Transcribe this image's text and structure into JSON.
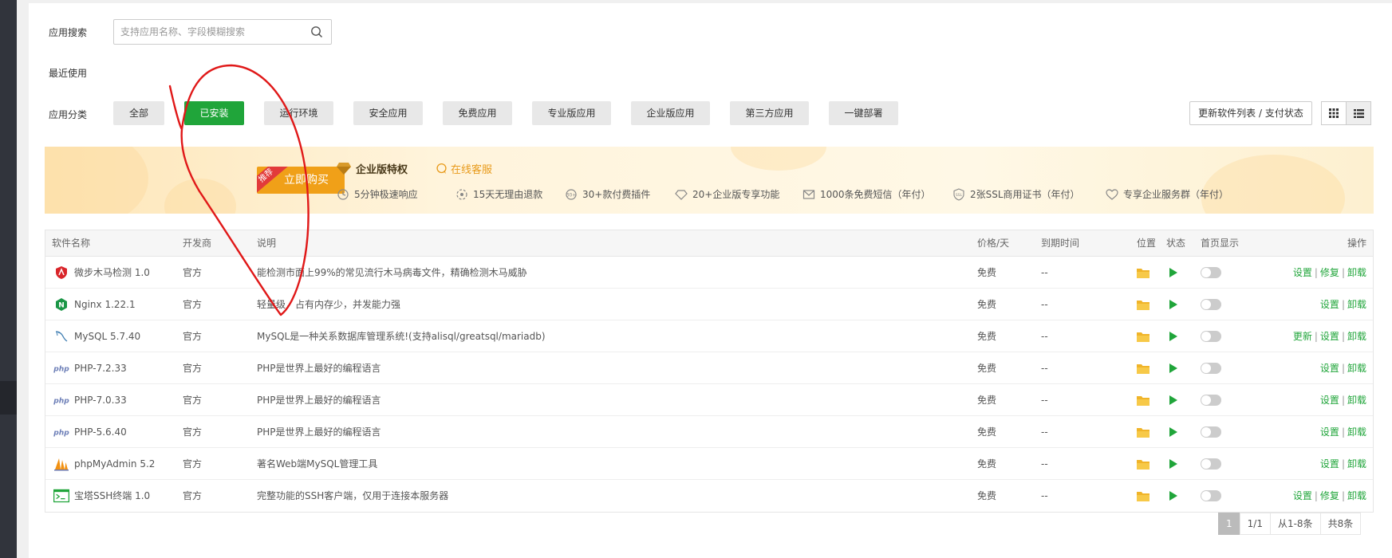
{
  "search": {
    "label": "应用搜索",
    "placeholder": "支持应用名称、字段模糊搜索",
    "value": ""
  },
  "recent": {
    "label": "最近使用"
  },
  "categories": {
    "label": "应用分类",
    "items": [
      {
        "label": "全部",
        "active": false
      },
      {
        "label": "已安装",
        "active": true
      },
      {
        "label": "运行环境",
        "active": false
      },
      {
        "label": "安全应用",
        "active": false
      },
      {
        "label": "免费应用",
        "active": false
      },
      {
        "label": "专业版应用",
        "active": false
      },
      {
        "label": "企业版应用",
        "active": false
      },
      {
        "label": "第三方应用",
        "active": false
      },
      {
        "label": "一键部署",
        "active": false
      }
    ]
  },
  "toolbar": {
    "refresh_label": "更新软件列表 / 支付状态",
    "view_mode": "list"
  },
  "promo": {
    "ribbon": "推荐",
    "buy_label": "立即购买",
    "title": "企业版特权",
    "service_link": "在线客服",
    "features": [
      {
        "icon": "fast-response-icon",
        "label": "5分钟极速响应"
      },
      {
        "icon": "refund-icon",
        "label": "15天无理由退款"
      },
      {
        "icon": "plugin-icon",
        "label": "30+款付费插件"
      },
      {
        "icon": "diamond-icon",
        "label": "20+企业版专享功能"
      },
      {
        "icon": "sms-icon",
        "label": "1000条免费短信（年付）"
      },
      {
        "icon": "ssl-icon",
        "label": "2张SSL商用证书（年付）"
      },
      {
        "icon": "group-icon",
        "label": "专享企业服务群（年付）"
      }
    ]
  },
  "table": {
    "headers": {
      "name": "软件名称",
      "developer": "开发商",
      "description": "说明",
      "price": "价格/天",
      "expiry": "到期时间",
      "location": "位置",
      "status": "状态",
      "home_display": "首页显示",
      "actions": "操作"
    },
    "rows": [
      {
        "icon": "shield-icon",
        "name": "微步木马检测 1.0",
        "developer": "官方",
        "description": "能检测市面上99%的常见流行木马病毒文件，精确检测木马威胁",
        "price": "免费",
        "expiry": "--",
        "actions": [
          "设置",
          "修复",
          "卸载"
        ]
      },
      {
        "icon": "nginx-icon",
        "name": "Nginx 1.22.1",
        "developer": "官方",
        "description": "轻量级，占有内存少，并发能力强",
        "price": "免费",
        "expiry": "--",
        "actions": [
          "设置",
          "卸载"
        ]
      },
      {
        "icon": "mysql-icon",
        "name": "MySQL 5.7.40",
        "developer": "官方",
        "description": "MySQL是一种关系数据库管理系统!(支持alisql/greatsql/mariadb)",
        "price": "免费",
        "expiry": "--",
        "actions": [
          "更新",
          "设置",
          "卸载"
        ]
      },
      {
        "icon": "php-icon",
        "name": "PHP-7.2.33",
        "developer": "官方",
        "description": "PHP是世界上最好的编程语言",
        "price": "免费",
        "expiry": "--",
        "actions": [
          "设置",
          "卸载"
        ]
      },
      {
        "icon": "php-icon",
        "name": "PHP-7.0.33",
        "developer": "官方",
        "description": "PHP是世界上最好的编程语言",
        "price": "免费",
        "expiry": "--",
        "actions": [
          "设置",
          "卸载"
        ]
      },
      {
        "icon": "php-icon",
        "name": "PHP-5.6.40",
        "developer": "官方",
        "description": "PHP是世界上最好的编程语言",
        "price": "免费",
        "expiry": "--",
        "actions": [
          "设置",
          "卸载"
        ]
      },
      {
        "icon": "phpmyadmin-icon",
        "name": "phpMyAdmin 5.2",
        "developer": "官方",
        "description": "著名Web端MySQL管理工具",
        "price": "免费",
        "expiry": "--",
        "actions": [
          "设置",
          "卸载"
        ]
      },
      {
        "icon": "terminal-icon",
        "name": "宝塔SSH终端 1.0",
        "developer": "官方",
        "description": "完整功能的SSH客户端，仅用于连接本服务器",
        "price": "免费",
        "expiry": "--",
        "actions": [
          "设置",
          "修复",
          "卸载"
        ]
      }
    ]
  },
  "pagination": {
    "current": "1",
    "pages": "1/1",
    "range": "从1-8条",
    "total": "共8条"
  },
  "colors": {
    "accent": "#20a53a",
    "promo_button": "#f0a018",
    "annotation": "#e01818"
  }
}
